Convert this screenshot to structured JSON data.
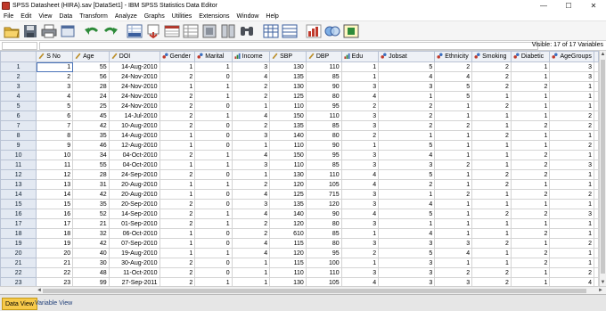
{
  "window": {
    "title": "SPSS Datasheet (HIRA).sav [DataSet1] - IBM SPSS Statistics Data Editor",
    "minimize": "—",
    "maximize": "☐",
    "close": "✕"
  },
  "menu": [
    "File",
    "Edit",
    "View",
    "Data",
    "Transform",
    "Analyze",
    "Graphs",
    "Utilities",
    "Extensions",
    "Window",
    "Help"
  ],
  "toolbar": {
    "icons": [
      "open-folder-icon",
      "save-icon",
      "print-icon",
      "recall-dialog-icon",
      "undo-icon",
      "redo-icon",
      "goto-case-icon",
      "goto-variable-icon",
      "variables-icon",
      "insert-case-icon",
      "insert-variable-icon",
      "split-file-icon",
      "find-icon",
      "weight-cases-icon",
      "select-cases-icon",
      "value-labels-icon",
      "use-sets-icon",
      "show-all-icon",
      "spelling-icon",
      "run-script-icon"
    ]
  },
  "cellbar": {
    "visible_label": "Visible: 17 of 17 Variables"
  },
  "grid": {
    "columns": [
      {
        "name": "S No",
        "kind": "scale"
      },
      {
        "name": "Age",
        "kind": "scale"
      },
      {
        "name": "DOI",
        "kind": "scale"
      },
      {
        "name": "Gender",
        "kind": "nominal"
      },
      {
        "name": "Marital",
        "kind": "nominal"
      },
      {
        "name": "Income",
        "kind": "ordinal"
      },
      {
        "name": "SBP",
        "kind": "scale"
      },
      {
        "name": "DBP",
        "kind": "scale"
      },
      {
        "name": "Edu",
        "kind": "ordinal"
      },
      {
        "name": "Jobsat",
        "kind": "nominal"
      },
      {
        "name": "Ethnicity",
        "kind": "nominal"
      },
      {
        "name": "Smoking",
        "kind": "nominal"
      },
      {
        "name": "Diabetic",
        "kind": "nominal"
      },
      {
        "name": "AgeGroups",
        "kind": "nominal"
      }
    ],
    "rows": [
      [
        "1",
        "55",
        "14-Aug-2010",
        "1",
        "1",
        "3",
        "130",
        "110",
        "1",
        "5",
        "2",
        "2",
        "1",
        "3"
      ],
      [
        "2",
        "56",
        "24-Nov-2010",
        "2",
        "0",
        "4",
        "135",
        "85",
        "1",
        "4",
        "4",
        "2",
        "1",
        "3"
      ],
      [
        "3",
        "28",
        "24-Nov-2010",
        "1",
        "1",
        "2",
        "130",
        "90",
        "3",
        "3",
        "5",
        "2",
        "2",
        "1"
      ],
      [
        "4",
        "24",
        "24-Nov-2010",
        "2",
        "1",
        "2",
        "125",
        "80",
        "4",
        "1",
        "5",
        "1",
        "1",
        "1"
      ],
      [
        "5",
        "25",
        "24-Nov-2010",
        "2",
        "0",
        "1",
        "110",
        "95",
        "2",
        "2",
        "1",
        "2",
        "1",
        "1"
      ],
      [
        "6",
        "45",
        "14-Jul-2010",
        "2",
        "1",
        "4",
        "150",
        "110",
        "3",
        "2",
        "1",
        "1",
        "1",
        "2"
      ],
      [
        "7",
        "42",
        "10-Aug-2010",
        "2",
        "0",
        "2",
        "135",
        "85",
        "3",
        "2",
        "2",
        "1",
        "2",
        "2"
      ],
      [
        "8",
        "35",
        "14-Aug-2010",
        "1",
        "0",
        "3",
        "140",
        "80",
        "2",
        "1",
        "1",
        "2",
        "1",
        "1"
      ],
      [
        "9",
        "46",
        "12-Aug-2010",
        "1",
        "0",
        "1",
        "110",
        "90",
        "1",
        "5",
        "1",
        "1",
        "1",
        "2"
      ],
      [
        "10",
        "34",
        "04-Oct-2010",
        "2",
        "1",
        "4",
        "150",
        "95",
        "3",
        "4",
        "1",
        "1",
        "2",
        "1"
      ],
      [
        "11",
        "55",
        "04-Oct-2010",
        "1",
        "1",
        "3",
        "110",
        "85",
        "3",
        "3",
        "2",
        "1",
        "2",
        "3"
      ],
      [
        "12",
        "28",
        "24-Sep-2010",
        "2",
        "0",
        "1",
        "130",
        "110",
        "4",
        "5",
        "1",
        "2",
        "2",
        "1"
      ],
      [
        "13",
        "31",
        "20-Aug-2010",
        "1",
        "1",
        "2",
        "120",
        "105",
        "4",
        "2",
        "1",
        "2",
        "1",
        "1"
      ],
      [
        "14",
        "42",
        "20-Aug-2010",
        "1",
        "0",
        "4",
        "125",
        "715",
        "3",
        "1",
        "2",
        "1",
        "2",
        "2"
      ],
      [
        "15",
        "35",
        "20-Sep-2010",
        "2",
        "0",
        "3",
        "135",
        "120",
        "3",
        "4",
        "1",
        "1",
        "1",
        "1"
      ],
      [
        "16",
        "52",
        "14-Sep-2010",
        "2",
        "1",
        "4",
        "140",
        "90",
        "4",
        "5",
        "1",
        "2",
        "2",
        "3"
      ],
      [
        "17",
        "21",
        "01-Sep-2010",
        "2",
        "1",
        "2",
        "120",
        "80",
        "3",
        "1",
        "1",
        "1",
        "1",
        "1"
      ],
      [
        "18",
        "32",
        "06-Oct-2010",
        "1",
        "0",
        "2",
        "610",
        "85",
        "1",
        "4",
        "1",
        "1",
        "2",
        "1"
      ],
      [
        "19",
        "42",
        "07-Sep-2010",
        "1",
        "0",
        "4",
        "115",
        "80",
        "3",
        "3",
        "3",
        "2",
        "1",
        "2"
      ],
      [
        "20",
        "40",
        "19-Aug-2010",
        "1",
        "1",
        "4",
        "120",
        "95",
        "2",
        "5",
        "4",
        "1",
        "2",
        "1"
      ],
      [
        "21",
        "30",
        "30-Aug-2010",
        "2",
        "0",
        "1",
        "115",
        "100",
        "1",
        "3",
        "1",
        "1",
        "2",
        "1"
      ],
      [
        "22",
        "48",
        "11-Oct-2010",
        "2",
        "0",
        "1",
        "110",
        "110",
        "3",
        "3",
        "2",
        "2",
        "1",
        "2"
      ],
      [
        "23",
        "99",
        "27-Sep-2011",
        "2",
        "1",
        "1",
        "130",
        "105",
        "4",
        "3",
        "3",
        "2",
        "1",
        "4"
      ]
    ]
  },
  "tabs": {
    "data_view": "Data View",
    "variable_view": "Variable View"
  },
  "scroll": {
    "up": "▲",
    "down": "▼",
    "left": "◄",
    "right": "►"
  },
  "colors": {
    "active_tab": "#f6c94a",
    "row_header": "#e3e9f2",
    "col_header": "#eef1f6"
  }
}
